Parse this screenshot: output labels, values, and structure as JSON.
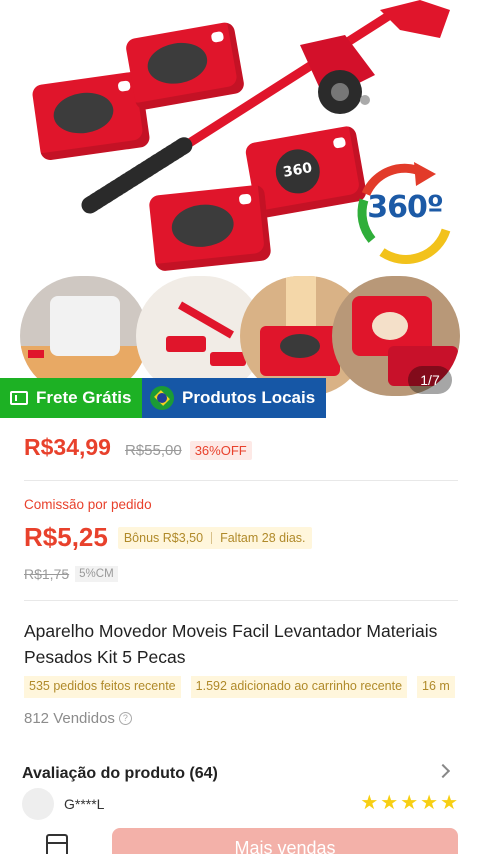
{
  "product_image": {
    "badge_text": "360º",
    "pad_badge_text": "360",
    "page_indicator": "1/7"
  },
  "tags": {
    "free_shipping": "Frete Grátis",
    "local_products": "Produtos Locais"
  },
  "pricing": {
    "price": "R$34,99",
    "original_price": "R$55,00",
    "discount": "36%OFF"
  },
  "commission": {
    "label": "Comissão por pedido",
    "value": "R$5,25",
    "bonus": "Bônus R$3,50",
    "remaining": "Faltam 28 dias.",
    "old_value": "R$1,75",
    "rate": "5%CM"
  },
  "product": {
    "title": "Aparelho Movedor Moveis Facil Levantador Materiais Pesados Kit 5 Pecas",
    "stats": [
      "535 pedidos feitos recente",
      "1.592 adicionado ao carrinho recente",
      "16 m"
    ],
    "sold": "812 Vendidos"
  },
  "reviews": {
    "title": "Avaliação do produto (64)",
    "reviewer": "G****L",
    "rating": 5
  },
  "bottom": {
    "cta_label": "Mais vendas"
  },
  "colors": {
    "accent": "#e8412c",
    "free_shipping_bg": "#1db124",
    "local_bg": "#1657a6",
    "star": "#f7cf13",
    "product_red": "#e0152b"
  }
}
